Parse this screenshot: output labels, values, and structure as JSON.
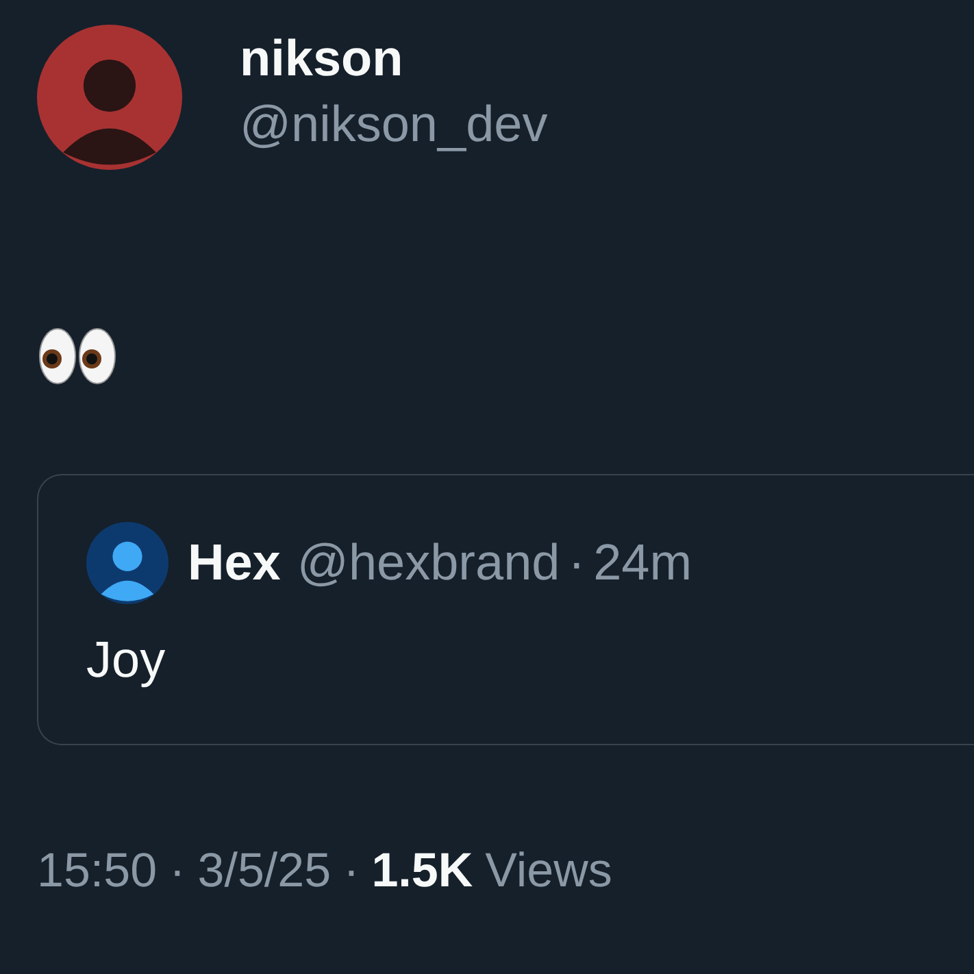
{
  "author": {
    "name": "nikson",
    "handle": "@nikson_dev"
  },
  "body": {
    "kind": "eyes-emoji"
  },
  "quote": {
    "name": "Hex",
    "handle": "@hexbrand",
    "separator": "·",
    "time": "24m",
    "text": "Joy"
  },
  "meta": {
    "time": "15:50",
    "separator": "·",
    "date": "3/5/25",
    "separator_2": "·",
    "views_count": "1.5K",
    "views_label": "Views"
  }
}
